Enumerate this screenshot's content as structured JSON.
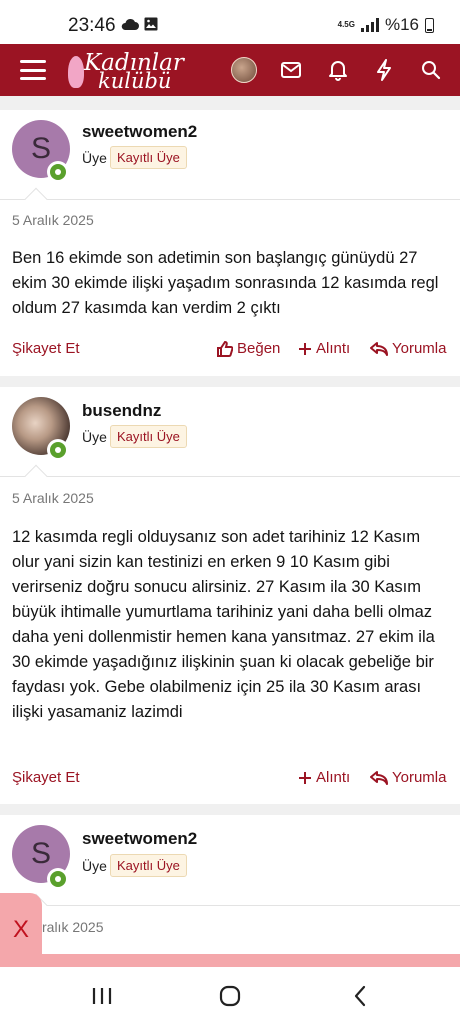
{
  "status_bar": {
    "time": "23:46",
    "network": "4.5G",
    "battery": "%16",
    "icons": [
      "cloud-icon",
      "image-icon",
      "signal-icon",
      "battery-icon"
    ]
  },
  "app_bar": {
    "logo_line1": "Kadınlar",
    "logo_line2": "kulübü",
    "icons": [
      "menu-icon",
      "avatar",
      "mail-icon",
      "bell-icon",
      "bolt-icon",
      "search-icon"
    ]
  },
  "posts": [
    {
      "username": "sweetwomen2",
      "avatar_letter": "S",
      "role": "Üye",
      "badge": "Kayıtlı Üye",
      "date": "5 Aralık 2025",
      "body": "Ben 16 ekimde son adetimin son başlangıç günüydü 27 ekim 30 ekimde ilişki yaşadım sonrasında 12 kasımda regl oldum 27 kasımda kan verdim 2 çıktı",
      "report": "Şikayet Et",
      "like": "Beğen",
      "quote": "Alıntı",
      "reply": "Yorumla"
    },
    {
      "username": "busendnz",
      "role": "Üye",
      "badge": "Kayıtlı Üye",
      "date": "5 Aralık 2025",
      "body": "12 kasımda regli olduysanız son adet tarihiniz 12 Kasım olur yani sizin kan testinizi en erken 9 10 Kasım gibi verirseniz doğru sonucu alirsiniz. 27 Kasım ila 30 Kasım büyük ihtimalle yumurtlama tarihiniz yani daha belli olmaz daha yeni dollenmistir hemen kana yansıtmaz. 27 ekim ila 30 ekimde yaşadığınız ilişkinin şuan ki olacak gebeliğe bir faydası yok. Gebe olabilmeniz için 25 ila 30 Kasım arası ilişki yasamaniz lazimdi",
      "report": "Şikayet Et",
      "quote": "Alıntı",
      "reply": "Yorumla"
    },
    {
      "username": "sweetwomen2",
      "avatar_letter": "S",
      "role": "Üye",
      "badge": "Kayıtlı Üye",
      "date_partial": "ralık 2025"
    }
  ],
  "overlay": {
    "close_label": "X"
  },
  "colors": {
    "brand": "#9b1423",
    "accent_pink": "#f4a7ab",
    "online": "#5aa02c",
    "badge_bg": "#fdf4e3"
  }
}
